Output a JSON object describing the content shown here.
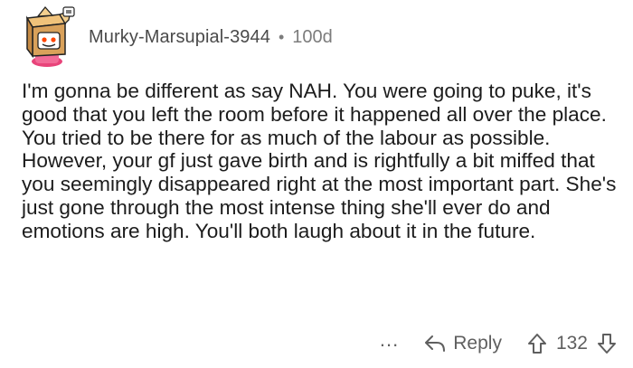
{
  "comment": {
    "author": "Murky-Marsupial-3944",
    "separator": "•",
    "age": "100d",
    "text": "I'm gonna be different as say NAH. You were going to puke, it's good that you left the room before it happened all over the place. You tried to be there for as much of the labour as possible. However, your gf just gave birth and is rightfully a bit miffed that you seemingly disappeared right at the most important part. She's just gone through the most intense thing she'll ever do and emotions are high. You'll both laugh about it in the future."
  },
  "actions": {
    "more_label": "...",
    "reply_label": "Reply",
    "score": "132"
  },
  "icons": {
    "avatar": "snoo-box-avatar",
    "reply": "reply-arrow-icon",
    "upvote": "upvote-arrow-icon",
    "downvote": "downvote-arrow-icon"
  },
  "colors": {
    "avatar_box": "#d9a15a",
    "avatar_accent": "#ff4500",
    "avatar_pink": "#e8447a",
    "text": "#1c1c1c",
    "meta": "#7c7c7c"
  }
}
